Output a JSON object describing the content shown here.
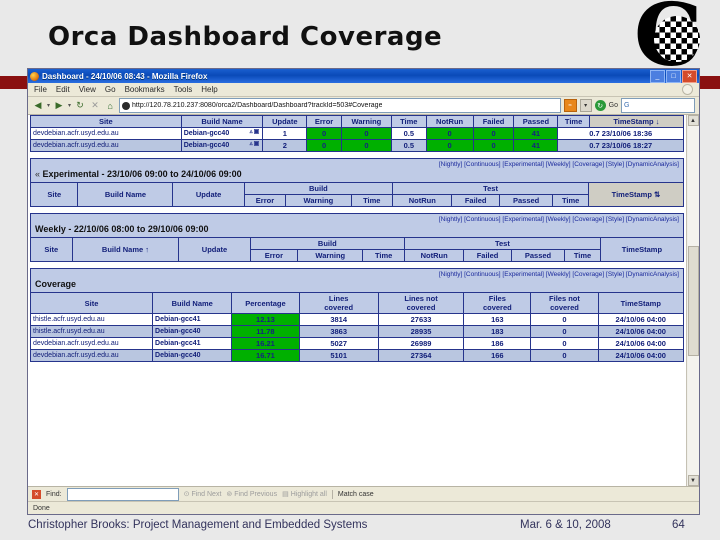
{
  "slide": {
    "title": "Orca Dashboard Coverage",
    "logo_letter": "C",
    "footer": {
      "author": "Christopher Brooks: Project Management and Embedded Systems",
      "date": "Mar. 6 & 10, 2008",
      "page": "64"
    }
  },
  "browser": {
    "window_title": "Dashboard - 24/10/06 08:43 - Mozilla Firefox",
    "window_buttons": {
      "minimize": "_",
      "maximize": "□",
      "close": "✕"
    },
    "menus": [
      "File",
      "Edit",
      "View",
      "Go",
      "Bookmarks",
      "Tools",
      "Help"
    ],
    "nav": {
      "back": "◀",
      "forward": "▶",
      "reload": "↻",
      "stop": "✕",
      "home": "⌂",
      "url": "http://120.78.210.237:8080/orca2/Dashboard/Dashboard?trackId=503#Coverage",
      "rss": "◉",
      "dropdown": "▼",
      "go_icon": "▶",
      "go_label": "Go",
      "search_placeholder": "",
      "search_icon": "G"
    },
    "findbar": {
      "close": "✕",
      "label": "Find:",
      "value": "",
      "find_next": "Find Next",
      "find_previous": "Find Previous",
      "highlight_all": "Highlight all",
      "match_case": "Match case"
    },
    "status": "Done"
  },
  "nav_links": [
    "[Nightly]",
    "[Continuous]",
    "[Experimental]",
    "[Weekly]",
    "[Coverage]",
    "[Style]",
    "[DynamicAnalysis]"
  ],
  "build_table": {
    "headers": {
      "site": "Site",
      "build_name": "Build Name",
      "update": "Update",
      "build_group": "Build",
      "test_group": "Test",
      "error": "Error",
      "warning": "Warning",
      "build_time": "Time",
      "notrun": "NotRun",
      "failed": "Failed",
      "passed": "Passed",
      "test_time": "Time",
      "timestamp": "TimeStamp",
      "sort_arrow": "↓",
      "sort_arrow_up": "↑"
    },
    "rows": [
      {
        "site": "devdebian.acfr.usyd.edu.au",
        "build_name": "Debian-gcc40",
        "update": "1",
        "error": "0",
        "warning": "0",
        "build_time": "0.5",
        "notrun": "0",
        "failed": "0",
        "passed": "41",
        "timestamp": "0.7 23/10/06 18:36"
      },
      {
        "site": "devdebian.acfr.usyd.edu.au",
        "build_name": "Debian-gcc40",
        "update": "2",
        "error": "0",
        "warning": "0",
        "build_time": "0.5",
        "notrun": "0",
        "failed": "0",
        "passed": "41",
        "timestamp": "0.7 23/10/06 18:27"
      }
    ]
  },
  "sections": {
    "experimental": {
      "chevron": "«",
      "title": "Experimental - 23/10/06 09:00 to 24/10/06 09:00"
    },
    "weekly": {
      "chevron": "",
      "title": "Weekly - 22/10/06 08:00 to 29/10/06 09:00"
    },
    "coverage": {
      "chevron": "",
      "title": "Coverage"
    }
  },
  "coverage_table": {
    "headers": {
      "site": "Site",
      "build_name": "Build Name",
      "percentage": "Percentage",
      "lines_covered_1": "Lines",
      "lines_covered_2": "covered",
      "lines_not_covered_1": "Lines not",
      "lines_not_covered_2": "covered",
      "files_covered_1": "Files",
      "files_covered_2": "covered",
      "files_not_covered_1": "Files not",
      "files_not_covered_2": "covered",
      "timestamp": "TimeStamp"
    },
    "rows": [
      {
        "site": "thistle.acfr.usyd.edu.au",
        "build_name": "Debian-gcc41",
        "percentage": "12.13",
        "lines_covered": "3814",
        "lines_not_covered": "27633",
        "files_covered": "163",
        "files_not_covered": "0",
        "timestamp": "24/10/06 04:00"
      },
      {
        "site": "thistle.acfr.usyd.edu.au",
        "build_name": "Debian-gcc40",
        "percentage": "11.78",
        "lines_covered": "3863",
        "lines_not_covered": "28935",
        "files_covered": "183",
        "files_not_covered": "0",
        "timestamp": "24/10/06 04:00"
      },
      {
        "site": "devdebian.acfr.usyd.edu.au",
        "build_name": "Debian-gcc41",
        "percentage": "16.21",
        "lines_covered": "5027",
        "lines_not_covered": "26989",
        "files_covered": "186",
        "files_not_covered": "0",
        "timestamp": "24/10/06 04:00"
      },
      {
        "site": "devdebian.acfr.usyd.edu.au",
        "build_name": "Debian-gcc40",
        "percentage": "16.71",
        "lines_covered": "5101",
        "lines_not_covered": "27364",
        "files_covered": "166",
        "files_not_covered": "0",
        "timestamp": "24/10/06 04:00"
      }
    ]
  },
  "colors": {
    "accent_green": "#00b000",
    "header_blue": "#bfcbe6",
    "row_blue": "#b9c6e0",
    "text_blue": "#13207a",
    "band_red": "#8a1010"
  }
}
